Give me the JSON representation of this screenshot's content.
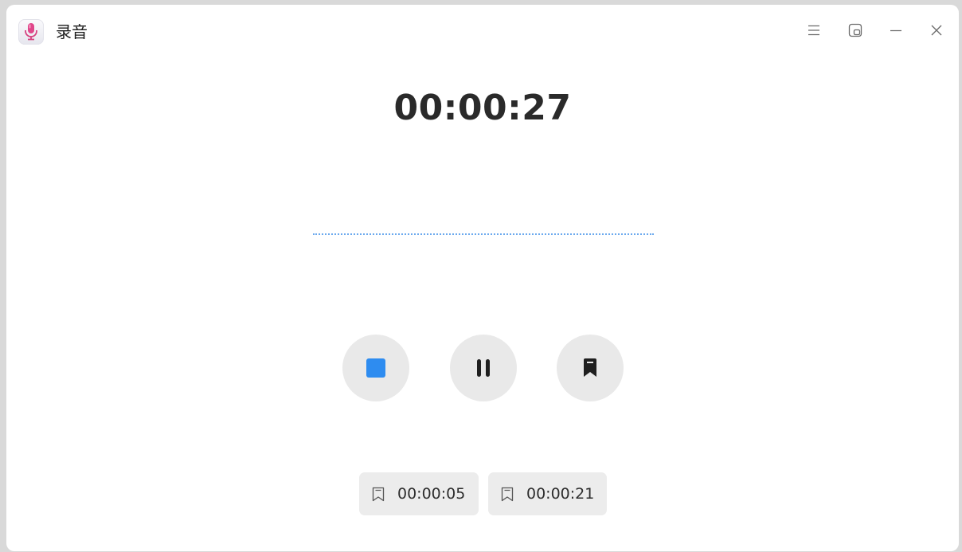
{
  "app": {
    "title": "录音",
    "icon": "microphone-icon"
  },
  "window_controls": {
    "menu_icon": "hamburger-menu-icon",
    "mini_mode_icon": "mini-window-icon",
    "minimize_icon": "minimize-icon",
    "close_icon": "close-icon"
  },
  "recording": {
    "elapsed": "00:00:27",
    "status": "recording"
  },
  "controls": {
    "stop_icon": "stop-icon",
    "pause_icon": "pause-icon",
    "mark_icon": "bookmark-icon"
  },
  "markers": [
    {
      "time": "00:00:05",
      "icon": "bookmark-outline-icon"
    },
    {
      "time": "00:00:21",
      "icon": "bookmark-outline-icon"
    }
  ],
  "colors": {
    "accent": "#2e8cf0",
    "wave": "#6ba9ee",
    "button_bg": "#e9e9e9",
    "mic_pink": "#e0478b"
  }
}
